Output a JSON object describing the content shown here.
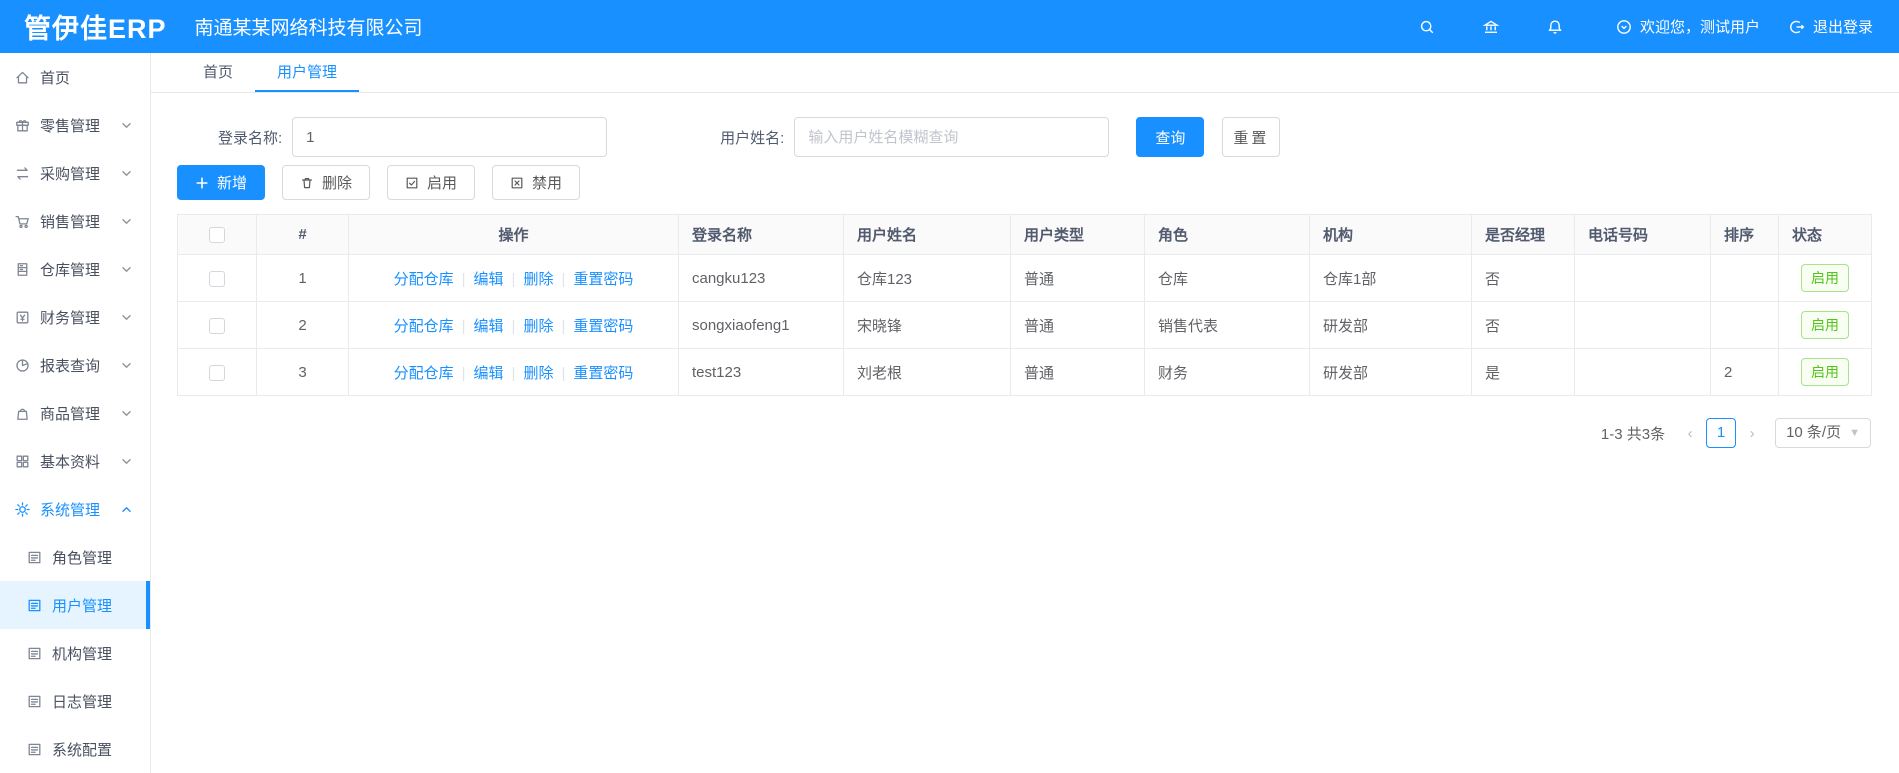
{
  "header": {
    "logo": "管伊佳ERP",
    "company": "南通某某网络科技有限公司",
    "welcome": "欢迎您，测试用户",
    "logout": "退出登录",
    "accent_color": "#1890ff"
  },
  "sidebar": {
    "items": [
      {
        "label": "首页",
        "icon": "home-icon"
      },
      {
        "label": "零售管理",
        "icon": "gift-icon"
      },
      {
        "label": "采购管理",
        "icon": "swap-icon"
      },
      {
        "label": "销售管理",
        "icon": "cart-icon"
      },
      {
        "label": "仓库管理",
        "icon": "warehouse-icon"
      },
      {
        "label": "财务管理",
        "icon": "finance-icon"
      },
      {
        "label": "报表查询",
        "icon": "pie-chart-icon"
      },
      {
        "label": "商品管理",
        "icon": "bag-icon"
      },
      {
        "label": "基本资料",
        "icon": "grid-icon"
      },
      {
        "label": "系统管理",
        "icon": "gear-icon"
      }
    ],
    "subitems": [
      {
        "label": "角色管理"
      },
      {
        "label": "用户管理"
      },
      {
        "label": "机构管理"
      },
      {
        "label": "日志管理"
      },
      {
        "label": "系统配置"
      }
    ]
  },
  "tabs": [
    {
      "label": "首页"
    },
    {
      "label": "用户管理"
    }
  ],
  "filters": {
    "login_label": "登录名称:",
    "login_value": "1",
    "name_label": "用户姓名:",
    "name_placeholder": "输入用户姓名模糊查询",
    "search_btn": "查询",
    "reset_btn": "重置"
  },
  "toolbar": {
    "add": "新增",
    "delete": "删除",
    "enable": "启用",
    "disable": "禁用"
  },
  "table": {
    "columns": [
      "#",
      "操作",
      "登录名称",
      "用户姓名",
      "用户类型",
      "角色",
      "机构",
      "是否经理",
      "电话号码",
      "排序",
      "状态"
    ],
    "rows": [
      {
        "index": "1",
        "ops": [
          "分配仓库",
          "编辑",
          "删除",
          "重置密码"
        ],
        "login": "cangku123",
        "name": "仓库123",
        "type": "普通",
        "role": "仓库",
        "org": "仓库1部",
        "manager": "否",
        "phone": "",
        "sort": "",
        "status": "启用"
      },
      {
        "index": "2",
        "ops": [
          "分配仓库",
          "编辑",
          "删除",
          "重置密码"
        ],
        "login": "songxiaofeng1",
        "name": "宋晓锋",
        "type": "普通",
        "role": "销售代表",
        "org": "研发部",
        "manager": "否",
        "phone": "",
        "sort": "",
        "status": "启用"
      },
      {
        "index": "3",
        "ops": [
          "分配仓库",
          "编辑",
          "删除",
          "重置密码"
        ],
        "login": "test123",
        "name": "刘老根",
        "type": "普通",
        "role": "财务",
        "org": "研发部",
        "manager": "是",
        "phone": "",
        "sort": "2",
        "status": "启用"
      }
    ],
    "status_color": "#52c41a"
  },
  "pagination": {
    "total": "1-3 共3条",
    "prev": "‹",
    "page": "1",
    "next": "›",
    "page_size": "10 条/页"
  }
}
